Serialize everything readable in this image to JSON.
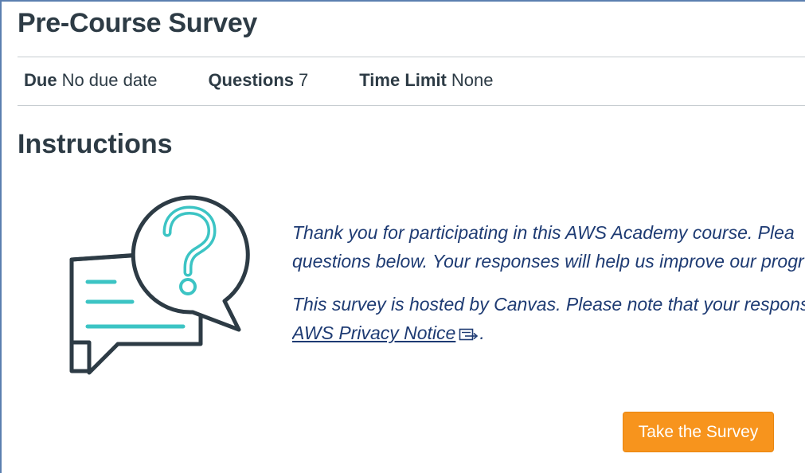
{
  "quiz": {
    "title": "Pre-Course Survey",
    "details": {
      "due_label": "Due",
      "due_value": "No due date",
      "questions_label": "Questions",
      "questions_value": "7",
      "time_limit_label": "Time Limit",
      "time_limit_value": "None"
    },
    "instructions_title": "Instructions",
    "instructions": {
      "line1": "Thank you for participating in this AWS Academy course. Plea",
      "line2": "questions below. Your responses will help us improve our progr",
      "line3": "This survey is hosted by Canvas. Please note that your respons",
      "link_text": "AWS Privacy Notice",
      "link_suffix": "."
    },
    "start_button_label": "Take the Survey"
  },
  "icons": {
    "illustration": "question-speech-bubble-icon",
    "external_link": "external-link-icon"
  },
  "colors": {
    "accent_button": "#f7941d",
    "instruction_text": "#1e3b73",
    "illustration_teal": "#3cc4c4",
    "illustration_outline": "#2d3b45"
  }
}
